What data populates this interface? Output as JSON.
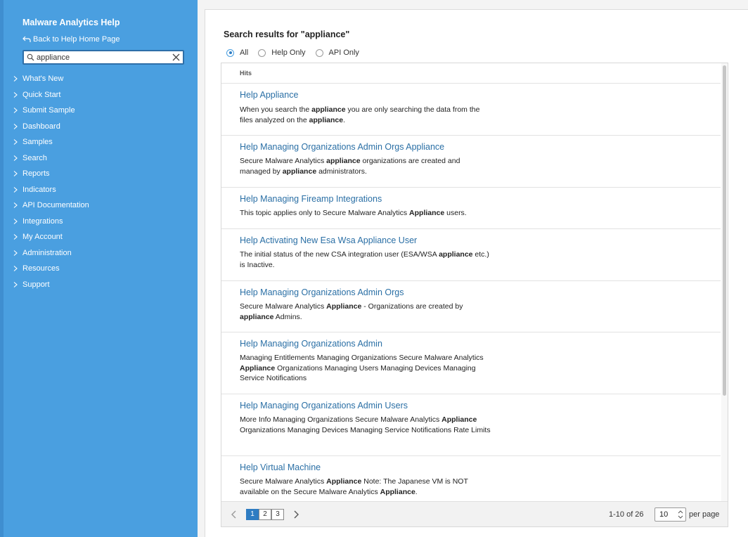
{
  "sidebar": {
    "title": "Malware Analytics Help",
    "back_link": "Back to Help Home Page",
    "search_value": "appliance",
    "items": [
      {
        "label": "What's New"
      },
      {
        "label": "Quick Start"
      },
      {
        "label": "Submit Sample"
      },
      {
        "label": "Dashboard"
      },
      {
        "label": "Samples"
      },
      {
        "label": "Search"
      },
      {
        "label": "Reports"
      },
      {
        "label": "Indicators"
      },
      {
        "label": "API Documentation"
      },
      {
        "label": "Integrations"
      },
      {
        "label": "My Account"
      },
      {
        "label": "Administration"
      },
      {
        "label": "Resources"
      },
      {
        "label": "Support"
      }
    ]
  },
  "main": {
    "title": "Search results for \"appliance\"",
    "filters": [
      {
        "label": "All",
        "checked": true
      },
      {
        "label": "Help Only",
        "checked": false
      },
      {
        "label": "API Only",
        "checked": false
      }
    ],
    "hits_header": "Hits",
    "results": [
      {
        "title": "Help Appliance",
        "body": [
          {
            "text": "When you search the "
          },
          {
            "text": "appliance",
            "bold": true
          },
          {
            "text": " you are only searching the data from the files analyzed on the "
          },
          {
            "text": "appliance",
            "bold": true
          },
          {
            "text": "."
          }
        ]
      },
      {
        "title": "Help Managing Organizations Admin Orgs Appliance",
        "body": [
          {
            "text": "Secure Malware Analytics "
          },
          {
            "text": "appliance",
            "bold": true
          },
          {
            "text": " organizations are created and managed by "
          },
          {
            "text": "appliance",
            "bold": true
          },
          {
            "text": " administrators."
          }
        ]
      },
      {
        "title": "Help Managing Fireamp Integrations",
        "body": [
          {
            "text": "This topic applies only to Secure Malware Analytics "
          },
          {
            "text": "Appliance",
            "bold": true
          },
          {
            "text": " users."
          }
        ]
      },
      {
        "title": "Help Activating New Esa Wsa Appliance User",
        "body": [
          {
            "text": "The initial status of the new CSA integration user (ESA/WSA "
          },
          {
            "text": "appliance",
            "bold": true
          },
          {
            "text": " etc.) is Inactive."
          }
        ]
      },
      {
        "title": "Help Managing Organizations Admin Orgs",
        "body": [
          {
            "text": "Secure Malware Analytics "
          },
          {
            "text": "Appliance",
            "bold": true
          },
          {
            "text": " - Organizations are created by "
          },
          {
            "text": "appliance",
            "bold": true
          },
          {
            "text": " Admins."
          }
        ]
      },
      {
        "title": "Help Managing Organizations Admin",
        "body": [
          {
            "text": "Managing Entitlements Managing Organizations Secure Malware Analytics "
          },
          {
            "text": "Appliance",
            "bold": true
          },
          {
            "text": " Organizations Managing Users Managing Devices Managing Service Notifications"
          }
        ]
      },
      {
        "title": "Help Managing Organizations Admin Users",
        "body": [
          {
            "text": "More Info Managing Organizations Secure Malware Analytics "
          },
          {
            "text": "Appliance",
            "bold": true
          },
          {
            "text": " Organizations Managing Devices Managing Service Notifications Rate Limits"
          }
        ]
      },
      {
        "title": "Help Virtual Machine",
        "body": [
          {
            "text": "Secure Malware Analytics "
          },
          {
            "text": "Appliance",
            "bold": true
          },
          {
            "text": " Note: The Japanese VM is NOT available on the Secure Malware Analytics "
          },
          {
            "text": "Appliance",
            "bold": true
          },
          {
            "text": "."
          }
        ]
      }
    ],
    "pagination": {
      "pages": [
        "1",
        "2",
        "3"
      ],
      "current_page": "1",
      "range": "1-10 of 26",
      "per_page_value": "10",
      "per_page_label": "per page"
    }
  },
  "colors": {
    "sidebar_bg": "#4a9fe0",
    "link": "#2a6fa5",
    "accent": "#2f7cc2"
  }
}
